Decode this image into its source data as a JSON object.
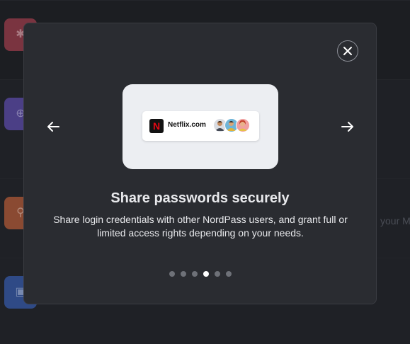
{
  "modal": {
    "title": "Share passwords securely",
    "description": "Share login credentials with other NordPass users, and grant full or limited access rights depending on your needs.",
    "close_icon": "close-icon",
    "prev_icon": "arrow-left-icon",
    "next_icon": "arrow-right-icon",
    "illustration": {
      "item_name": "Netflix.com",
      "logo_letter": "N",
      "avatars": [
        "avatar-1",
        "avatar-2",
        "avatar-3"
      ]
    },
    "pagination": {
      "total": 6,
      "active": 4
    }
  },
  "background": {
    "partial_text": "your M",
    "icon_colors": [
      "#7a3440",
      "#4b3f86",
      "#8a4a32",
      "#2f4a86"
    ]
  }
}
